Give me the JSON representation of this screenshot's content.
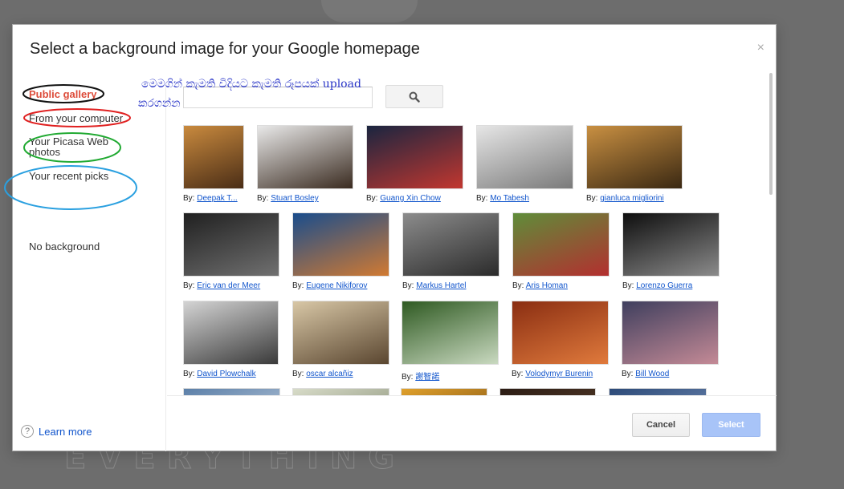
{
  "dialog": {
    "title": "Select a background image for your Google homepage",
    "close_label": "×"
  },
  "sidebar": {
    "items": [
      {
        "label": "Public gallery",
        "active": true
      },
      {
        "label": "From your computer"
      },
      {
        "label": "Your Picasa Web photos"
      },
      {
        "label": "Your recent picks"
      },
      {
        "label": "No background"
      }
    ],
    "learn_more": "Learn more",
    "help_glyph": "?"
  },
  "annotation": {
    "line1": "මෙමගින් කැමති විදියට කැමති රූපයක් upload",
    "line2": "කරගන්න",
    "color": "#2a36c8"
  },
  "search": {
    "placeholder": "",
    "icon": "search-icon"
  },
  "gallery": {
    "by_label": "By:",
    "images": [
      {
        "author": "Deepak T...",
        "colors": [
          "#c98a3e",
          "#4a2d16"
        ]
      },
      {
        "author": "Stuart Bosley",
        "colors": [
          "#e9e9e9",
          "#3a2b20"
        ]
      },
      {
        "author": "Guang Xin Chow",
        "colors": [
          "#1a2540",
          "#c2372f"
        ]
      },
      {
        "author": "Mo Tabesh",
        "colors": [
          "#e6e6e6",
          "#7a7a7a"
        ]
      },
      {
        "author": "gianluca migliorini",
        "colors": [
          "#c99042",
          "#3a2812"
        ]
      },
      {
        "author": "Eric van der Meer",
        "colors": [
          "#202020",
          "#707070"
        ]
      },
      {
        "author": "Eugene Nikiforov",
        "colors": [
          "#1a4d8c",
          "#d17a32"
        ]
      },
      {
        "author": "Markus Hartel",
        "colors": [
          "#8c8c8c",
          "#2b2b2b"
        ]
      },
      {
        "author": "Aris Homan",
        "colors": [
          "#5f8d3a",
          "#b32f2f"
        ]
      },
      {
        "author": "Lorenzo Guerra",
        "colors": [
          "#0e0e0e",
          "#8b8b8b"
        ]
      },
      {
        "author": "David Plowchalk",
        "colors": [
          "#d4d4d4",
          "#3a3a3a"
        ]
      },
      {
        "author": "oscar alcañiz",
        "colors": [
          "#d8c7a6",
          "#5a4630"
        ]
      },
      {
        "author": "謝智諾",
        "colors": [
          "#2f5a22",
          "#c9d9c0"
        ]
      },
      {
        "author": "Volodymyr Burenin",
        "colors": [
          "#8a2e12",
          "#e07a3c"
        ]
      },
      {
        "author": "Bill Wood",
        "colors": [
          "#3f3f5e",
          "#c48a96"
        ]
      },
      {
        "author": "",
        "colors": [
          "#5b7fa8",
          "#dfe6ee"
        ]
      },
      {
        "author": "",
        "colors": [
          "#d8dcc9",
          "#6b7358"
        ]
      },
      {
        "author": "",
        "colors": [
          "#e0a12c",
          "#5a3208"
        ]
      },
      {
        "author": "",
        "colors": [
          "#2b1c14",
          "#6a4a32"
        ]
      },
      {
        "author": "",
        "colors": [
          "#2c4a78",
          "#8aa2c9"
        ]
      }
    ]
  },
  "buttons": {
    "cancel": "Cancel",
    "select": "Select"
  }
}
